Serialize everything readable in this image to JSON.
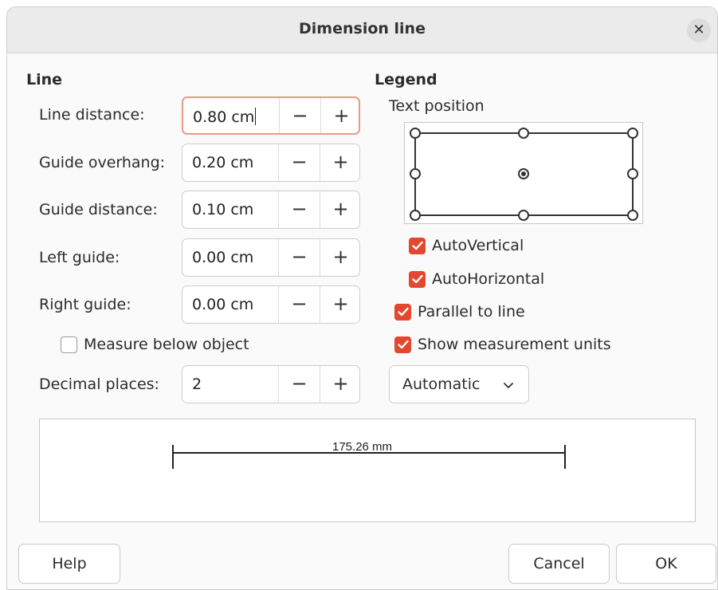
{
  "window": {
    "title": "Dimension line",
    "close_glyph": "✕"
  },
  "line_section": {
    "title": "Line",
    "fields": [
      {
        "label": "Line distance:",
        "value": "0.80 cm"
      },
      {
        "label": "Guide overhang:",
        "value": "0.20 cm"
      },
      {
        "label": "Guide distance:",
        "value": "0.10 cm"
      },
      {
        "label": "Left guide:",
        "value": "0.00 cm"
      },
      {
        "label": "Right guide:",
        "value": "0.00 cm"
      }
    ],
    "measure_below": {
      "label": "Measure below object",
      "checked": false
    },
    "decimal_places": {
      "label": "Decimal places:",
      "value": "2"
    },
    "minus_glyph": "−",
    "plus_glyph": "+"
  },
  "legend_section": {
    "title": "Legend",
    "text_position_label": "Text position",
    "selected_position": "center",
    "auto_vertical": {
      "label": "AutoVertical",
      "checked": true
    },
    "auto_horizontal": {
      "label": "AutoHorizontal",
      "checked": true
    },
    "parallel_to_line": {
      "label": "Parallel to line",
      "checked": true
    },
    "show_units": {
      "label": "Show measurement units",
      "checked": true
    },
    "units_dropdown": {
      "value": "Automatic"
    }
  },
  "preview": {
    "measurement_text": "175.26 mm"
  },
  "buttons": {
    "help": "Help",
    "cancel": "Cancel",
    "ok": "OK"
  },
  "colors": {
    "accent": "#e3482e",
    "focus_border": "#e79a8a",
    "titlebar": "#ebebeb"
  }
}
